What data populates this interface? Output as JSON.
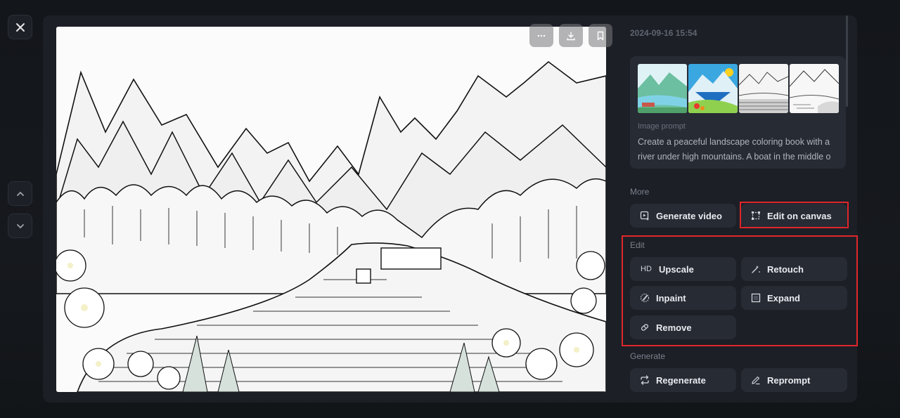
{
  "nav": {
    "close_icon": "close-icon",
    "prev_icon": "chevron-up-icon",
    "next_icon": "chevron-down-icon"
  },
  "image_toolbar": {
    "more_icon": "ellipsis-icon",
    "download_icon": "download-icon",
    "bookmark_icon": "bookmark-icon"
  },
  "main_image": {
    "description": "Black-and-white coloring book landscape: mountains, forest, river with boats and flowers"
  },
  "details": {
    "timestamp": "2024-09-16 15:54",
    "thumbnails": [
      {
        "label": "Colorful landscape variant 1"
      },
      {
        "label": "Colorful landscape variant 2"
      },
      {
        "label": "Line art variant 3"
      },
      {
        "label": "Line art variant 4"
      }
    ],
    "prompt_label": "Image prompt",
    "prompt_lines": [
      "Create a peaceful landscape coloring book with a",
      "river under high mountains. A boat in the middle o"
    ]
  },
  "sections": {
    "more": {
      "title": "More",
      "buttons": [
        {
          "label": "Generate video",
          "icon": "video-plus-icon"
        },
        {
          "label": "Edit on canvas",
          "icon": "canvas-edit-icon"
        }
      ]
    },
    "edit": {
      "title": "Edit",
      "buttons": [
        {
          "label": "Upscale",
          "icon": "HD"
        },
        {
          "label": "Retouch",
          "icon": "magic-wand-icon"
        },
        {
          "label": "Inpaint",
          "icon": "inpaint-brush-icon"
        },
        {
          "label": "Expand",
          "icon": "expand-icon"
        },
        {
          "label": "Remove",
          "icon": "eraser-icon"
        }
      ]
    },
    "generate": {
      "title": "Generate",
      "buttons": [
        {
          "label": "Regenerate",
          "icon": "repeat-icon"
        },
        {
          "label": "Reprompt",
          "icon": "pencil-icon"
        }
      ]
    }
  },
  "colors": {
    "highlight": "#e0262b",
    "panel": "#1c1f26",
    "button": "#272b34"
  }
}
